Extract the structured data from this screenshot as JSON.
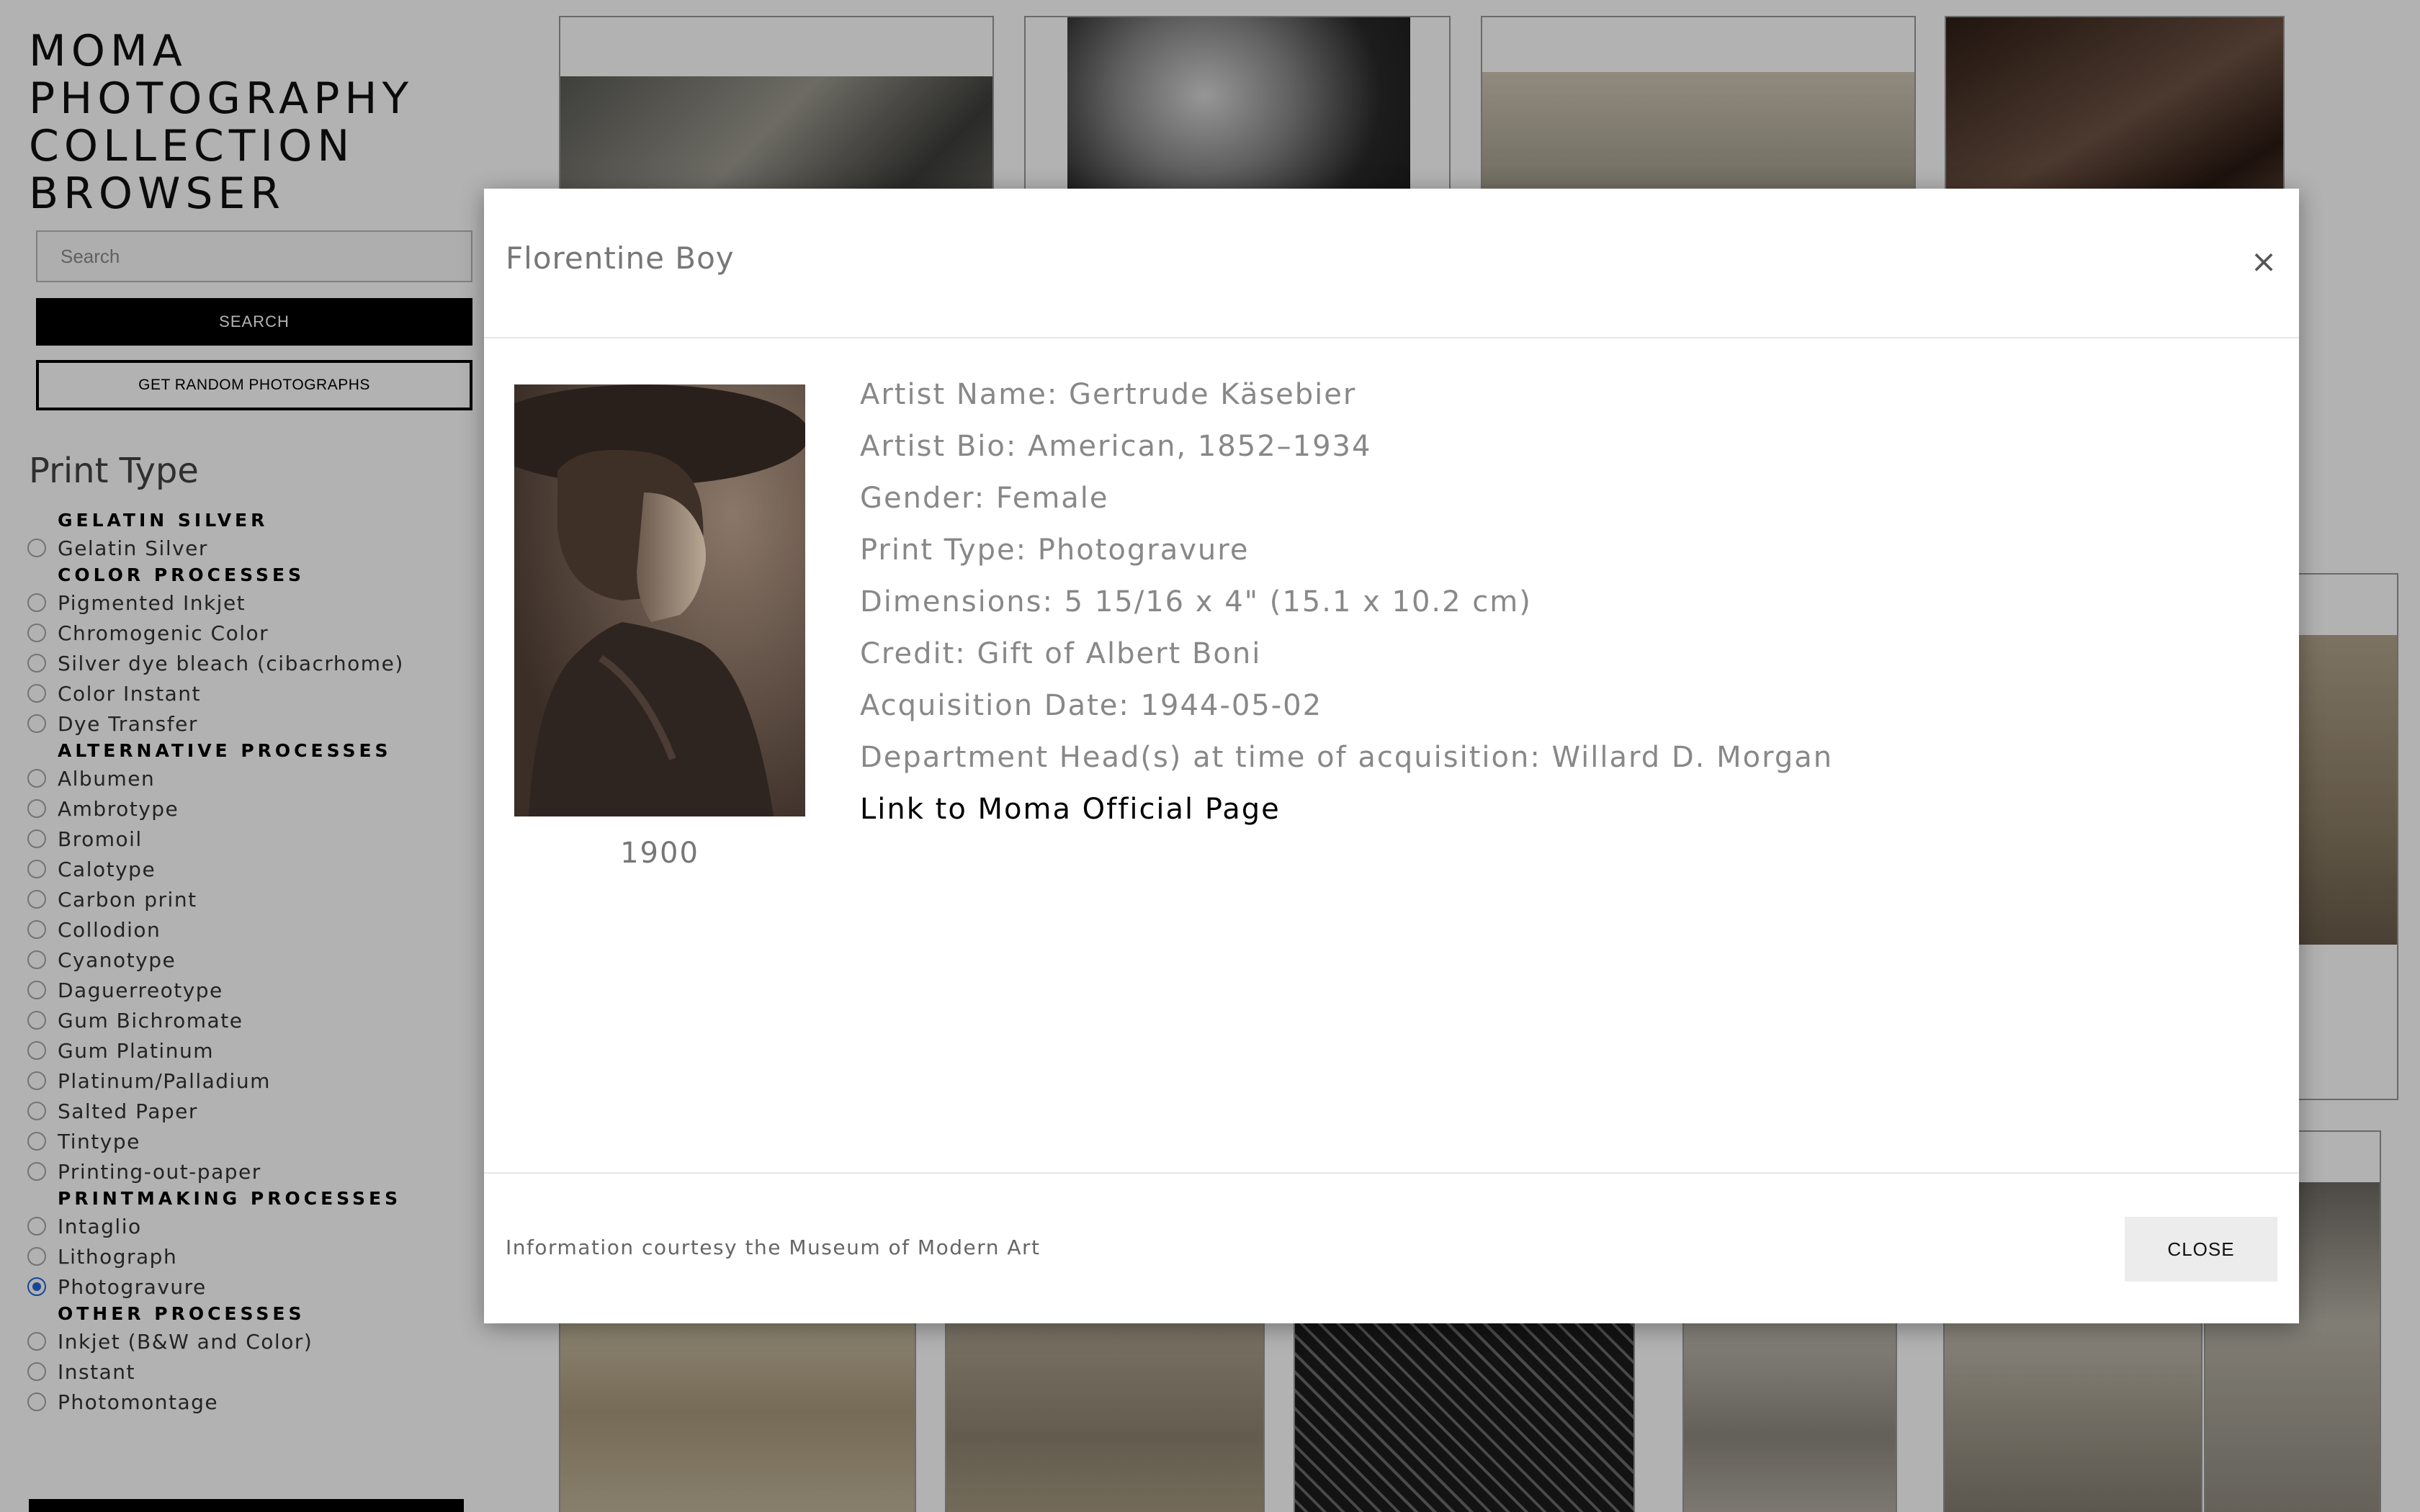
{
  "app": {
    "title_lines": [
      "MOMA",
      "PHOTOGRAPHY",
      "COLLECTION",
      "BROWSER"
    ]
  },
  "search": {
    "placeholder": "Search",
    "button_label": "SEARCH",
    "random_label": "GET RANDOM PHOTOGRAPHS"
  },
  "filters": {
    "heading": "Print Type",
    "selected": "Photogravure",
    "groups": [
      {
        "heading": "GELATIN SILVER",
        "options": [
          "Gelatin Silver"
        ]
      },
      {
        "heading": "COLOR PROCESSES",
        "options": [
          "Pigmented Inkjet",
          "Chromogenic Color",
          "Silver dye bleach (cibacrhome)",
          "Color Instant",
          "Dye Transfer"
        ]
      },
      {
        "heading": "ALTERNATIVE PROCESSES",
        "options": [
          "Albumen",
          "Ambrotype",
          "Bromoil",
          "Calotype",
          "Carbon print",
          "Collodion",
          "Cyanotype",
          "Daguerreotype",
          "Gum Bichromate",
          "Gum Platinum",
          "Platinum/Palladium",
          "Salted Paper",
          "Tintype",
          "Printing-out-paper"
        ]
      },
      {
        "heading": "PRINTMAKING PROCESSES",
        "options": [
          "Intaglio",
          "Lithograph",
          "Photogravure"
        ]
      },
      {
        "heading": "OTHER PROCESSES",
        "options": [
          "Inkjet (B&W and Color)",
          "Instant",
          "Photomontage"
        ]
      }
    ]
  },
  "modal": {
    "title": "Florentine Boy",
    "close_x": "×",
    "year": "1900",
    "details": [
      "Artist Name: Gertrude Käsebier",
      "Artist Bio: American, 1852–1934",
      "Gender: Female",
      "Print Type: Photogravure",
      "Dimensions: 5 15/16 x 4\" (15.1 x 10.2 cm)",
      "Credit: Gift of Albert Boni",
      "Acquisition Date: 1944-05-02",
      "Department Head(s) at time of acquisition: Willard D. Morgan"
    ],
    "link_label": "Link to Moma Official Page",
    "footer_note": "Information courtesy the Museum of Modern Art",
    "close_label": "CLOSE"
  },
  "colors": {
    "selected_radio": "#1e66d6",
    "search_button_bg": "#000000",
    "backdrop": "rgba(0,0,0,0.30)"
  }
}
